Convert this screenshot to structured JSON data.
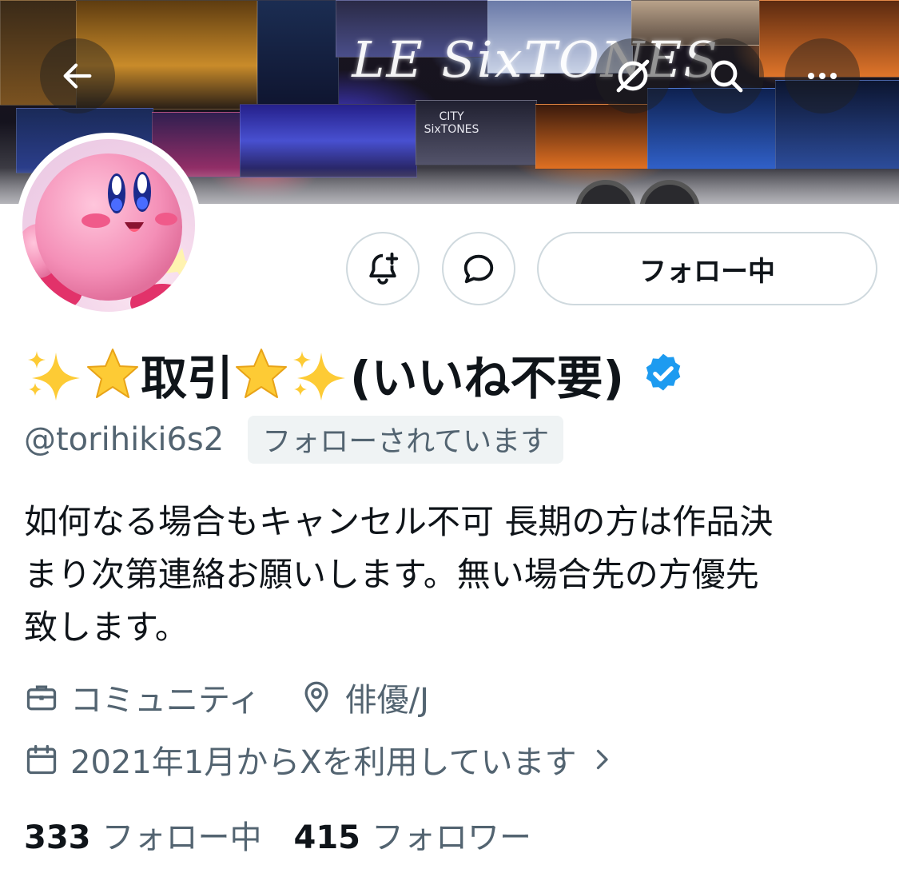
{
  "banner": {
    "logo_text": "LE SixTONES",
    "small_sign": "CITY SixTONES"
  },
  "nav": {
    "back_icon": "arrow-left-icon",
    "grok_icon": "grok-icon",
    "search_icon": "search-icon",
    "more_icon": "more-icon"
  },
  "actions": {
    "notifications_icon": "bell-plus-icon",
    "message_icon": "message-bubble-icon",
    "follow_label": "フォロー中"
  },
  "profile": {
    "name_text": "取引",
    "name_suffix": "(いいね不要)",
    "name_emojis": [
      "sparkles-emoji",
      "star-emoji",
      "star-emoji",
      "sparkles-emoji"
    ],
    "verified_icon": "verified-badge-icon",
    "handle": "@torihiki6s2",
    "follows_you": "フォローされています",
    "bio_lines": [
      "如何なる場合もキャンセル不可 長期の方は作品決",
      "まり次第連絡お願いします。無い場合先の方優先",
      "致します。"
    ],
    "category": "コミュニティ",
    "location": "俳優/J",
    "joined": "2021年1月からXを利用しています"
  },
  "stats": {
    "following_count": "333",
    "following_label": "フォロー中",
    "followers_count": "415",
    "followers_label": "フォロワー"
  },
  "colors": {
    "text_primary": "#0f1419",
    "text_secondary": "#536471",
    "border": "#cfd9de",
    "verified_blue": "#1d9bf0",
    "star_yellow": "#fdcb35"
  }
}
